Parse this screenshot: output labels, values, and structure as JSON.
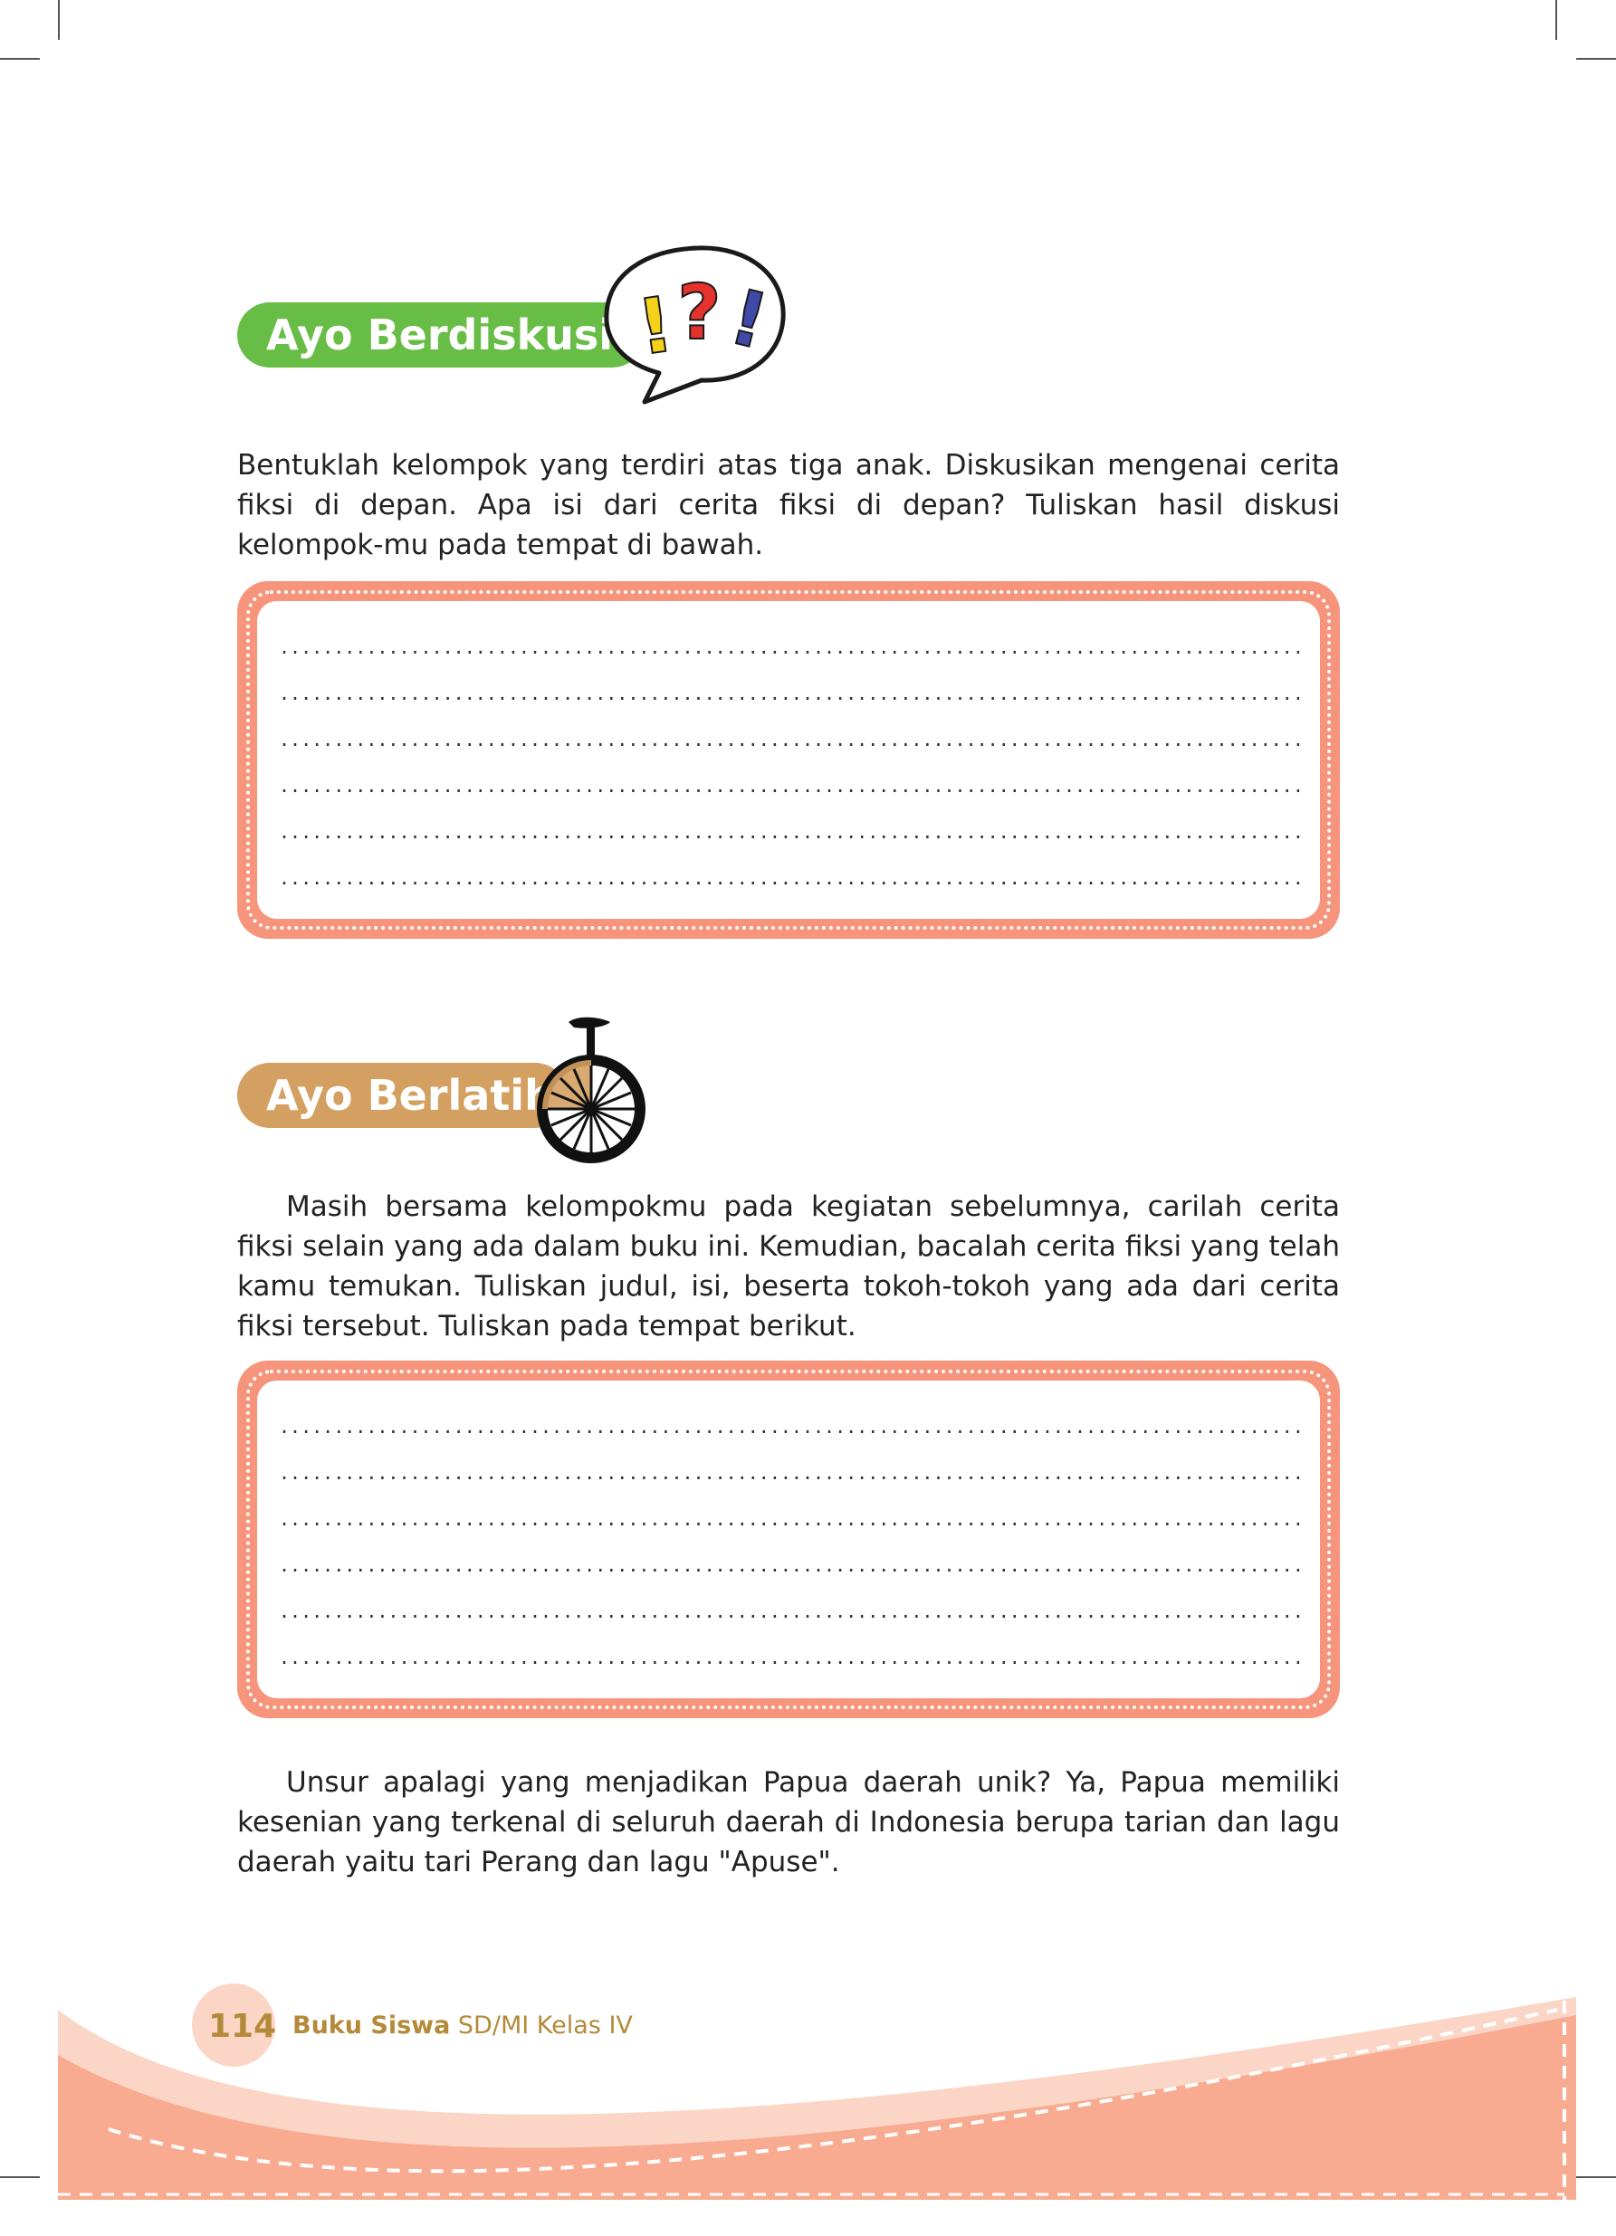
{
  "sections": {
    "diskusi": {
      "title": "Ayo Berdiskusi",
      "paragraph": "Bentuklah kelompok yang terdiri atas tiga anak. Diskusikan mengenai cerita fiksi di depan. Apa isi dari cerita fiksi di depan? Tuliskan hasil diskusi kelompok-mu pada tempat di bawah."
    },
    "berlatih": {
      "title": "Ayo Berlatih",
      "paragraph": "Masih bersama kelompokmu pada kegiatan sebelumnya, carilah cerita fiksi selain yang ada dalam buku ini. Kemudian, bacalah cerita fiksi yang telah kamu temukan. Tuliskan judul, isi, beserta tokoh-tokoh yang ada dari cerita fiksi tersebut.  Tuliskan pada tempat berikut."
    },
    "closing": {
      "paragraph": "Unsur apalagi yang menjadikan Papua daerah unik? Ya, Papua memiliki kesenian yang terkenal di seluruh daerah di Indonesia berupa tarian dan lagu daerah yaitu tari Perang dan lagu \"Apuse\"."
    }
  },
  "answer_line": "..........................................................................................................................................................................................................................................",
  "speech_bubble": {
    "marks": [
      "!",
      "?",
      "!"
    ],
    "colors": [
      "#f5d11b",
      "#e5322d",
      "#3f4aa8"
    ]
  },
  "footer": {
    "page_number": "114",
    "book_title_bold": "Buku Siswa",
    "book_title_rest": "SD/MI Kelas IV"
  },
  "colors": {
    "diskusi_pill": "#67bd45",
    "berlatih_pill": "#d4a062",
    "answer_frame": "#f6957c",
    "footer_wave": "#f8ab90",
    "footer_light": "#fbd6c6",
    "footer_text": "#b48a3a"
  }
}
